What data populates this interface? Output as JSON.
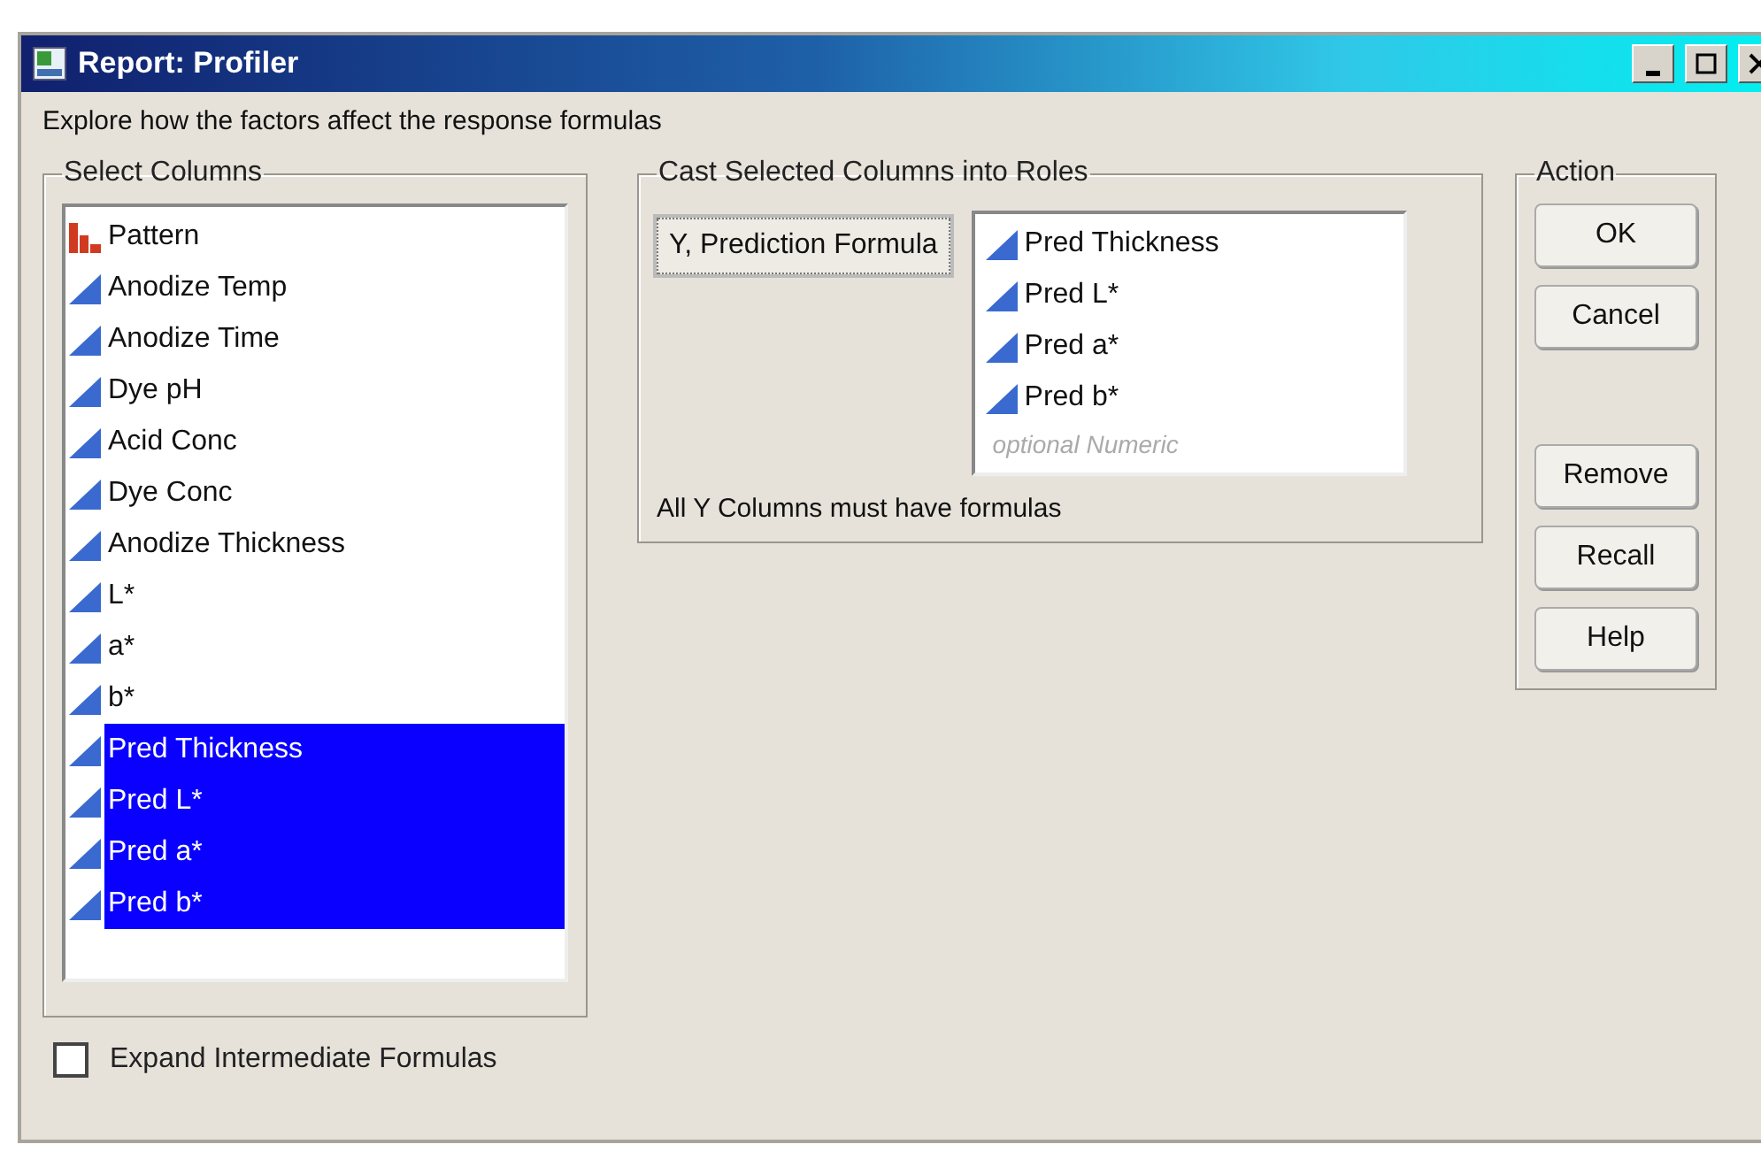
{
  "window": {
    "title": "Report: Profiler"
  },
  "description": "Explore how the factors affect the response formulas",
  "select_columns": {
    "title": "Select Columns",
    "items": [
      {
        "label": "Pattern",
        "kind": "nominal",
        "selected": false
      },
      {
        "label": "Anodize Temp",
        "kind": "continuous",
        "selected": false
      },
      {
        "label": "Anodize Time",
        "kind": "continuous",
        "selected": false
      },
      {
        "label": "Dye pH",
        "kind": "continuous",
        "selected": false
      },
      {
        "label": "Acid Conc",
        "kind": "continuous",
        "selected": false
      },
      {
        "label": "Dye Conc",
        "kind": "continuous",
        "selected": false
      },
      {
        "label": "Anodize Thickness",
        "kind": "continuous",
        "selected": false
      },
      {
        "label": "L*",
        "kind": "continuous",
        "selected": false
      },
      {
        "label": "a*",
        "kind": "continuous",
        "selected": false
      },
      {
        "label": "b*",
        "kind": "continuous",
        "selected": false
      },
      {
        "label": "Pred Thickness",
        "kind": "continuous",
        "selected": true
      },
      {
        "label": "Pred L*",
        "kind": "continuous",
        "selected": true
      },
      {
        "label": "Pred a*",
        "kind": "continuous",
        "selected": true
      },
      {
        "label": "Pred b*",
        "kind": "continuous",
        "selected": true
      }
    ]
  },
  "expand_intermediate": {
    "label": "Expand Intermediate Formulas",
    "checked": false
  },
  "cast_roles": {
    "title": "Cast Selected Columns into Roles",
    "role_button": "Y, Prediction Formula",
    "items": [
      {
        "label": "Pred Thickness",
        "kind": "continuous"
      },
      {
        "label": "Pred L*",
        "kind": "continuous"
      },
      {
        "label": "Pred a*",
        "kind": "continuous"
      },
      {
        "label": "Pred b*",
        "kind": "continuous"
      }
    ],
    "placeholder": "optional Numeric",
    "note": "All Y Columns must have formulas"
  },
  "action": {
    "title": "Action",
    "buttons": [
      "OK",
      "Cancel",
      "Remove",
      "Recall",
      "Help"
    ]
  }
}
